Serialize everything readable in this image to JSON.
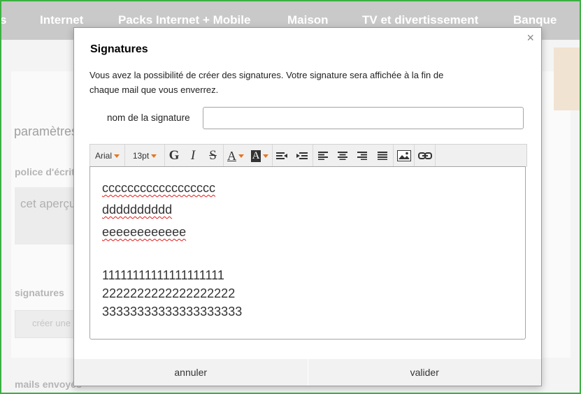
{
  "nav": {
    "items": [
      "s",
      "Internet",
      "Packs Internet + Mobile",
      "Maison",
      "TV et divertissement",
      "Banque"
    ]
  },
  "background": {
    "title": "paramètres",
    "font_label": "police d'écriture",
    "preview_text": "cet aperçu",
    "signatures_label": "signatures",
    "create_button": "créer une",
    "sent_label": "mails envoyés"
  },
  "modal": {
    "close": "×",
    "title": "Signatures",
    "description": "Vous avez la possibilité de créer des signatures. Votre signature sera affichée à la fin de chaque mail que vous enverrez.",
    "name_label": "nom de la signature",
    "name_value": "",
    "toolbar": {
      "font": "Arial",
      "size": "13pt",
      "bold": "G",
      "italic": "I",
      "strike": "S",
      "font_color": "A",
      "bg_color": "A"
    },
    "editor_lines": [
      "cccccccccccccccccc",
      "dddddddddd",
      "eeeeeeeeeeee",
      "11111111111111111111",
      "2222222222222222222",
      "33333333333333333333"
    ],
    "cancel": "annuler",
    "validate": "valider"
  },
  "colors": {
    "frame": "#3cb043",
    "accent": "#e8741f",
    "nav_bg": "#c9c9c9"
  }
}
